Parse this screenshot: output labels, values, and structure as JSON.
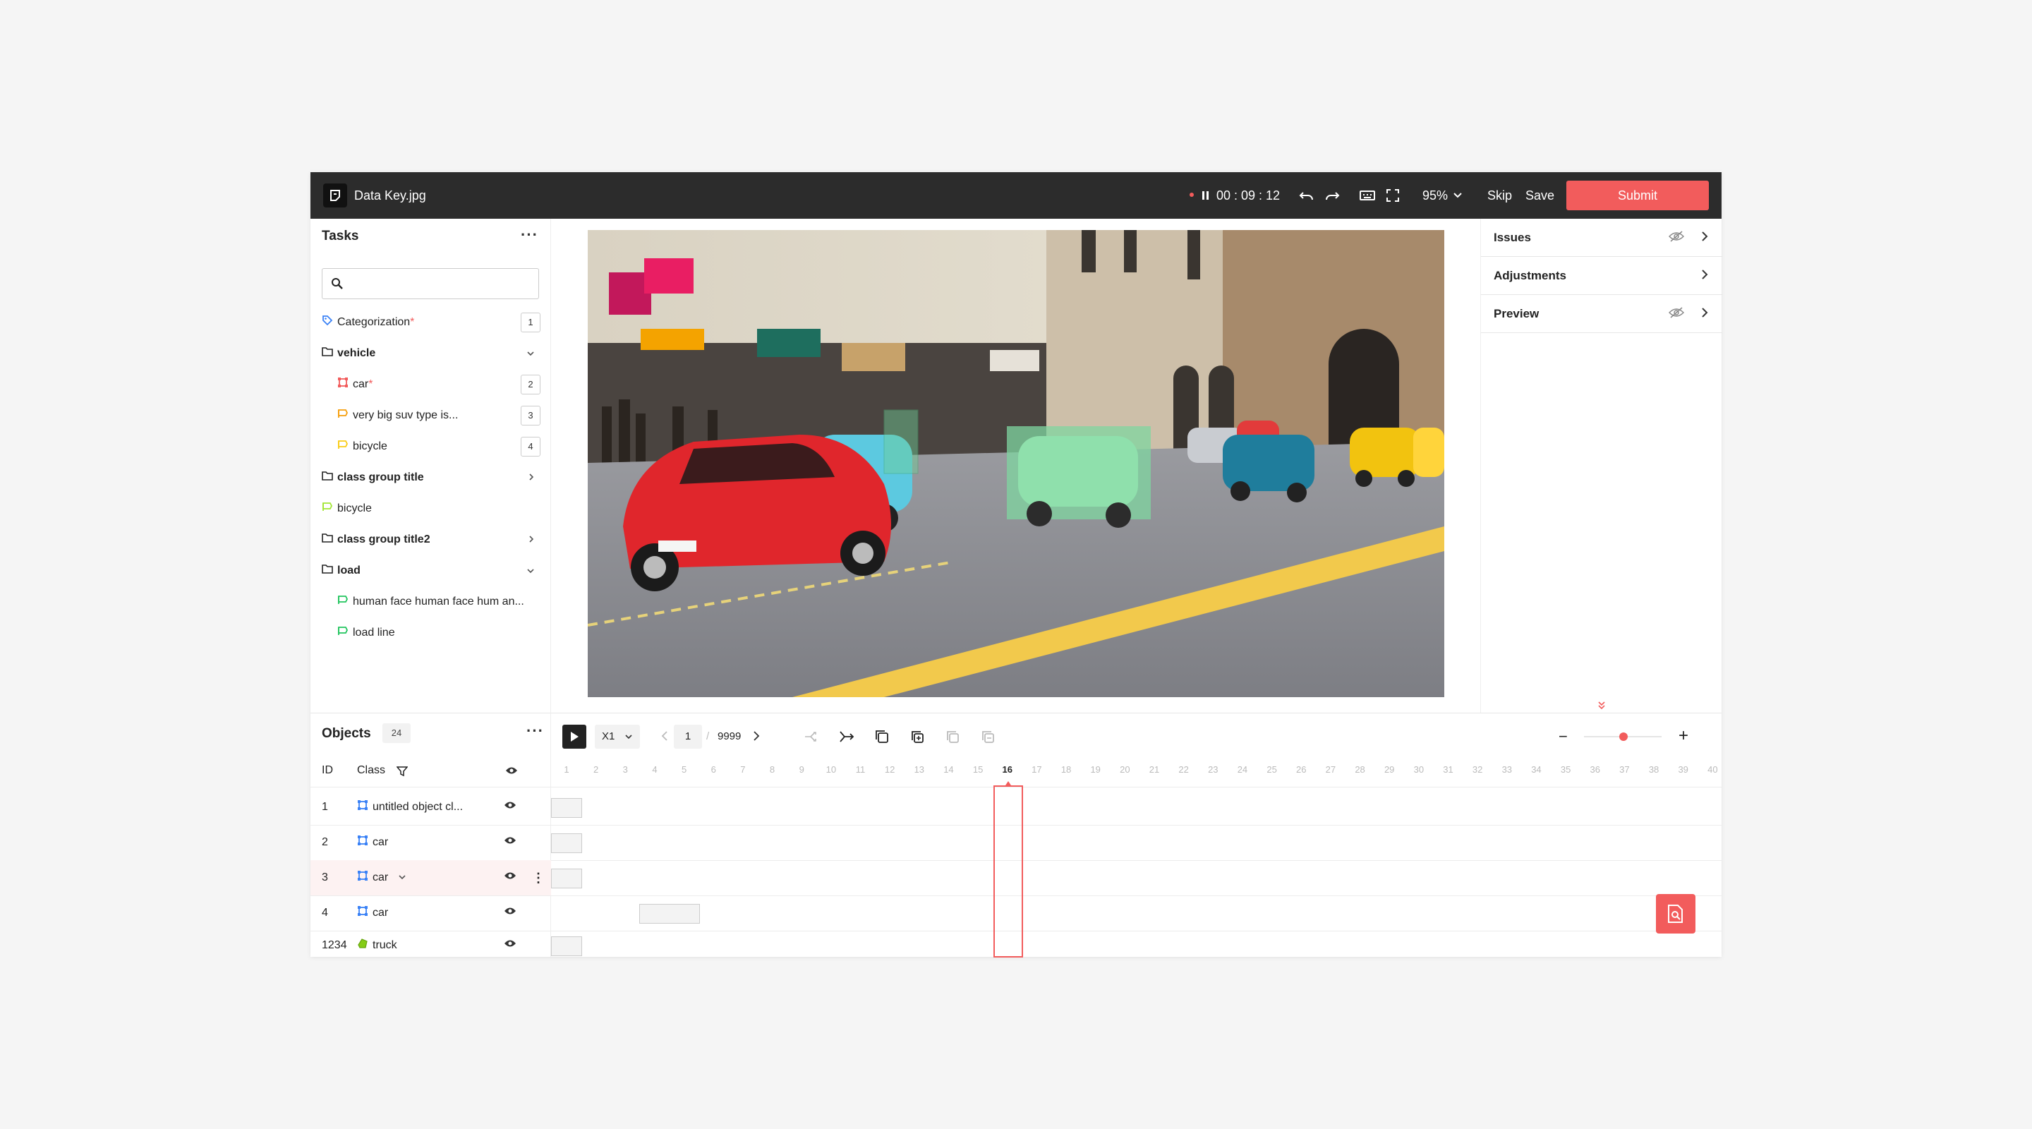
{
  "header": {
    "file_name": "Data Key.jpg",
    "timer": "00 : 09 : 12",
    "zoom": "95%",
    "skip_label": "Skip",
    "save_label": "Save",
    "submit_label": "Submit"
  },
  "tasks": {
    "title": "Tasks",
    "search_placeholder": "",
    "items": [
      {
        "label": "Categorization",
        "required": "*",
        "badge": "1",
        "icon": "tag-icon",
        "color": "#3b82f6"
      },
      {
        "label": "vehicle",
        "group": true,
        "expanded": true
      },
      {
        "label": "car",
        "required": "*",
        "badge": "2",
        "icon": "bbox-icon",
        "color": "#f25c5c"
      },
      {
        "label": "very big suv type is...",
        "badge": "3",
        "icon": "polyline-icon",
        "color": "#f59e0b"
      },
      {
        "label": "bicycle",
        "badge": "4",
        "icon": "polyline-icon",
        "color": "#facc15"
      },
      {
        "label": "class group title",
        "group": true,
        "expanded": false
      },
      {
        "label": "bicycle",
        "icon": "polyline-icon",
        "color": "#a3e635"
      },
      {
        "label": "class group title2",
        "group": true,
        "expanded": false
      },
      {
        "label": "load",
        "group": true,
        "expanded": true
      },
      {
        "label": "human face human face hum an...",
        "icon": "polyline-icon",
        "color": "#22c55e"
      },
      {
        "label": "load line",
        "icon": "polyline-icon",
        "color": "#22c55e"
      }
    ]
  },
  "right_panel": {
    "issues": "Issues",
    "adjustments": "Adjustments",
    "preview": "Preview"
  },
  "objects": {
    "title": "Objects",
    "count": "24",
    "col_id": "ID",
    "col_class": "Class",
    "rows": [
      {
        "id": "1",
        "cls": "untitled object cl...",
        "icon_color": "#3b82f6"
      },
      {
        "id": "2",
        "cls": "car",
        "icon_color": "#3b82f6"
      },
      {
        "id": "3",
        "cls": "car",
        "icon_color": "#3b82f6",
        "selected": true
      },
      {
        "id": "4",
        "cls": "car",
        "icon_color": "#3b82f6"
      },
      {
        "id": "1234",
        "cls": "truck",
        "icon_color": "#84cc16"
      }
    ]
  },
  "player": {
    "speed": "X1",
    "current_frame": "1",
    "total_frames": "9999",
    "active_tick": "16",
    "ticks": [
      "1",
      "2",
      "3",
      "4",
      "5",
      "6",
      "7",
      "8",
      "9",
      "10",
      "11",
      "12",
      "13",
      "14",
      "15",
      "16",
      "17",
      "18",
      "19",
      "20",
      "21",
      "22",
      "23",
      "24",
      "25",
      "26",
      "27",
      "28",
      "29",
      "30",
      "31",
      "32",
      "33",
      "34",
      "35",
      "36",
      "37",
      "38",
      "39",
      "40"
    ]
  },
  "colors": {
    "accent": "#f25c5c",
    "topbar": "#2c2c2c"
  }
}
